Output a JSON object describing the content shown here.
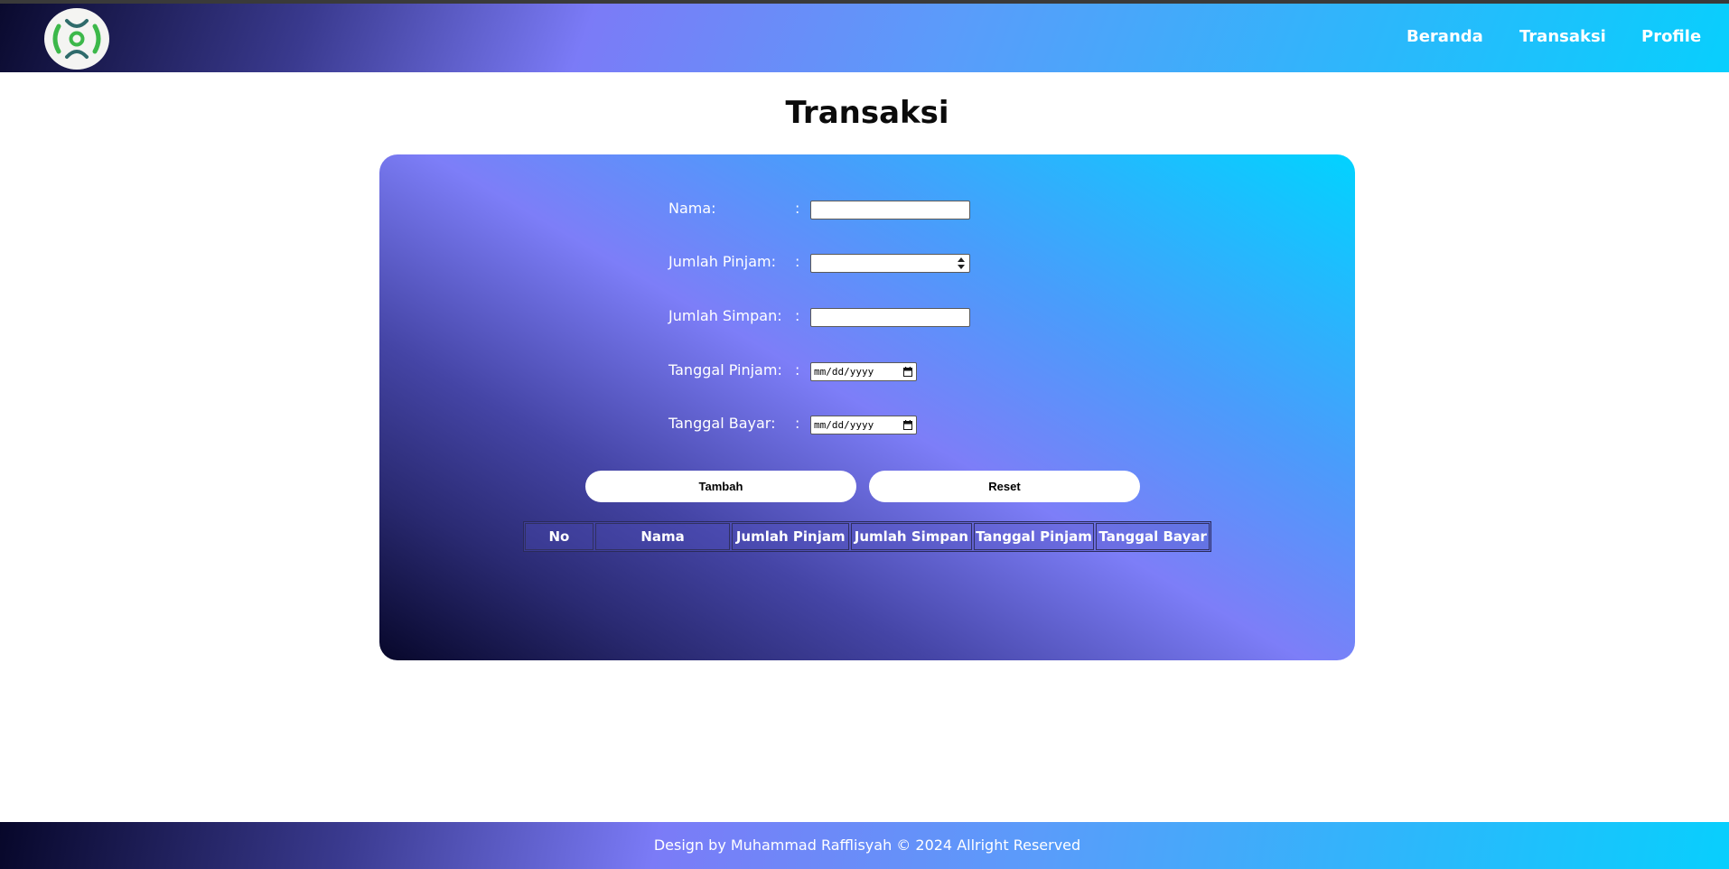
{
  "nav": {
    "links": [
      "Beranda",
      "Transaksi",
      "Profile"
    ]
  },
  "page": {
    "title": "Transaksi"
  },
  "form": {
    "fields": [
      {
        "label": "Nama:",
        "value": ""
      },
      {
        "label": "Jumlah Pinjam:",
        "value": ""
      },
      {
        "label": "Jumlah Simpan:",
        "value": ""
      },
      {
        "label": "Tanggal Pinjam:",
        "value": "mm/dd/yyyy"
      },
      {
        "label": "Tanggal Bayar:",
        "value": "mm/dd/yyyy"
      }
    ],
    "colon": ":",
    "buttons": {
      "add": "Tambah",
      "reset": "Reset"
    }
  },
  "table": {
    "headers": [
      "No",
      "Nama",
      "Jumlah Pinjam",
      "Jumlah Simpan",
      "Tanggal Pinjam",
      "Tanggal Bayar"
    ]
  },
  "footer": {
    "text": "Design by Muhammad Rafflisyah © 2024 Allright Reserved"
  },
  "colors": {
    "accent_start": "#0a0a2e",
    "accent_mid": "#7b7bf7",
    "accent_end": "#08cffd",
    "logo_green": "#3cb84a",
    "logo_teal": "#2f6b6b"
  },
  "icons": [
    "app-logo-icon",
    "spinner-arrows-icon",
    "calendar-icon"
  ]
}
